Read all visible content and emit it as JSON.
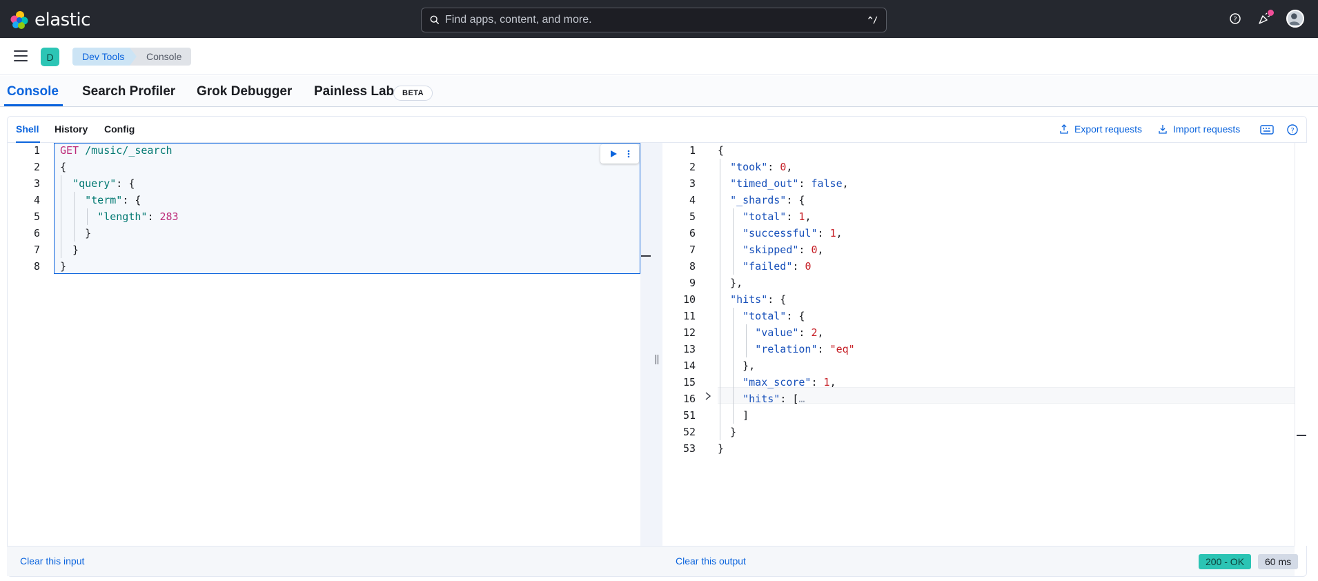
{
  "app": {
    "logo_text": "elastic",
    "search_placeholder": "Find apps, content, and more.",
    "search_shortcut": "^/"
  },
  "breadcrumb": {
    "space_initial": "D",
    "items": [
      "Dev Tools",
      "Console"
    ]
  },
  "page_tabs": {
    "items": [
      "Console",
      "Search Profiler",
      "Grok Debugger",
      "Painless Lab"
    ],
    "active": "Console",
    "beta_label": "BETA"
  },
  "console": {
    "sub_tabs": [
      "Shell",
      "History",
      "Config"
    ],
    "active_sub_tab": "Shell",
    "export_label": "Export requests",
    "import_label": "Import requests",
    "clear_input_label": "Clear this input",
    "clear_output_label": "Clear this output",
    "status_badge": "200 - OK",
    "time_badge": "60 ms"
  },
  "request": {
    "line_numbers": [
      "1",
      "2",
      "3",
      "4",
      "5",
      "6",
      "7",
      "8"
    ],
    "method": "GET",
    "path": " /music/_search",
    "lines": [
      "{",
      "  \"query\": {",
      "    \"term\": {",
      "      \"length\": 283",
      "    }",
      "  }",
      "}"
    ]
  },
  "response": {
    "line_numbers": [
      "1",
      "2",
      "3",
      "4",
      "5",
      "6",
      "7",
      "8",
      "9",
      "10",
      "11",
      "12",
      "13",
      "14",
      "15",
      "16",
      "51",
      "52",
      "53"
    ],
    "tokens": {
      "took": "0",
      "timed_out": "false",
      "total_shards": "1",
      "successful": "1",
      "skipped": "0",
      "failed": "0",
      "hits_value": "2",
      "relation": "\"eq\"",
      "max_score": "1"
    }
  },
  "colors": {
    "accent": "#0b64dd",
    "header_bg": "#25282f",
    "status_ok": "#2bc4b4"
  }
}
